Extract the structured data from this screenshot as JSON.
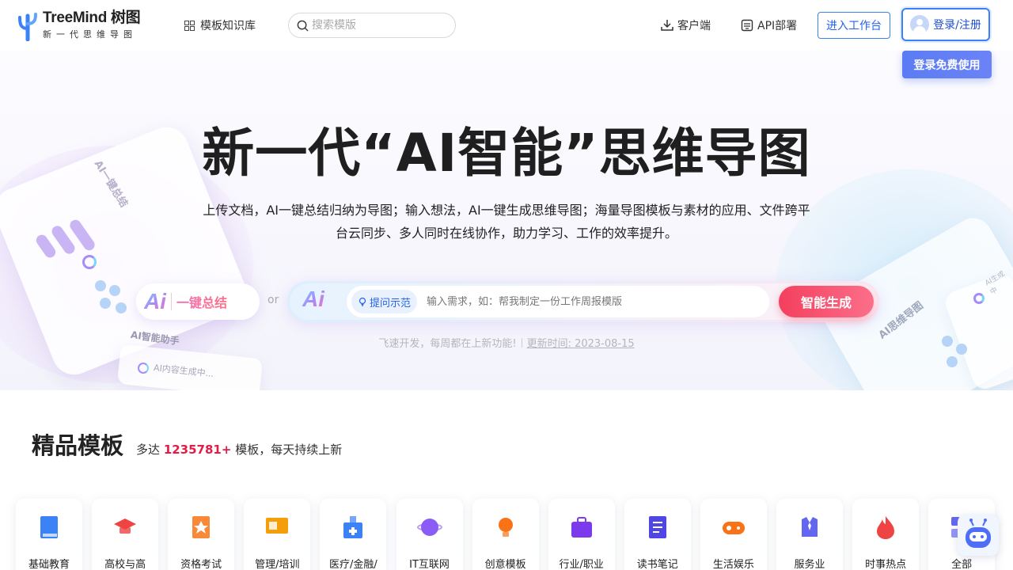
{
  "brand": {
    "name": "TreeMind 树图",
    "tagline": "新一代思维导图"
  },
  "nav": {
    "template_lib": "模板知识库",
    "search_placeholder": "搜索模版",
    "client": "客户端",
    "api": "API部署",
    "workspace": "进入工作台",
    "login": "登录/注册",
    "login_tip": "登录免费使用"
  },
  "hero": {
    "title": "新一代“AI智能”思维导图",
    "description": "上传文档，AI一键总结归纳为导图；输入想法，AI一键生成思维导图；海量导图模板与素材的应用、文件跨平台云同步、多人同时在线协作，助力学习、工作的效率提升。",
    "ai_logo": "Ai",
    "summary_label": "一键总结",
    "or": "or",
    "tip_label": "提问示范",
    "input_placeholder": "输入需求，如：帮我制定一份工作周报模版",
    "generate_button": "智能生成",
    "updates_text": "飞速开发，每周都在上新功能!",
    "updated_text": "更新时间: 2023-08-15",
    "deco_left_title": "AI一键总结",
    "deco_left_assist": "AI智能助手",
    "deco_left_generating": "AI内容生成中...",
    "deco_right_title": "AI思维导图",
    "deco_right_small": "AI生成中"
  },
  "templates": {
    "title": "精品模板",
    "sub_prefix": "多达",
    "count": "1235781+",
    "sub_suffix": "模板，每天持续上新",
    "categories": [
      {
        "label": "基础教育",
        "icon": "book-icon",
        "color": "#3b82f6"
      },
      {
        "label": "高校与高",
        "icon": "graduation-cap-icon",
        "color": "#ef4444"
      },
      {
        "label": "资格考试",
        "icon": "certificate-icon",
        "color": "#f97316"
      },
      {
        "label": "管理/培训",
        "icon": "presentation-icon",
        "color": "#f59e0b"
      },
      {
        "label": "医疗/金融/",
        "icon": "hospital-icon",
        "color": "#3b82f6"
      },
      {
        "label": "IT互联网",
        "icon": "planet-icon",
        "color": "#8b5cf6"
      },
      {
        "label": "创意模板",
        "icon": "lightbulb-icon",
        "color": "#f97316"
      },
      {
        "label": "行业/职业",
        "icon": "briefcase-icon",
        "color": "#7c3aed"
      },
      {
        "label": "读书笔记",
        "icon": "notebook-icon",
        "color": "#4f46e5"
      },
      {
        "label": "生活娱乐",
        "icon": "gamepad-icon",
        "color": "#f97316"
      },
      {
        "label": "服务业",
        "icon": "uniform-icon",
        "color": "#6366f1"
      },
      {
        "label": "时事热点",
        "icon": "flame-icon",
        "color": "#ef4444"
      },
      {
        "label": "全部",
        "icon": "grid-icon",
        "color": "#6366f1"
      }
    ]
  },
  "colors": {
    "accent": "#3b82f6",
    "generate": "#f43f5e",
    "highlight": "#e11d48"
  }
}
